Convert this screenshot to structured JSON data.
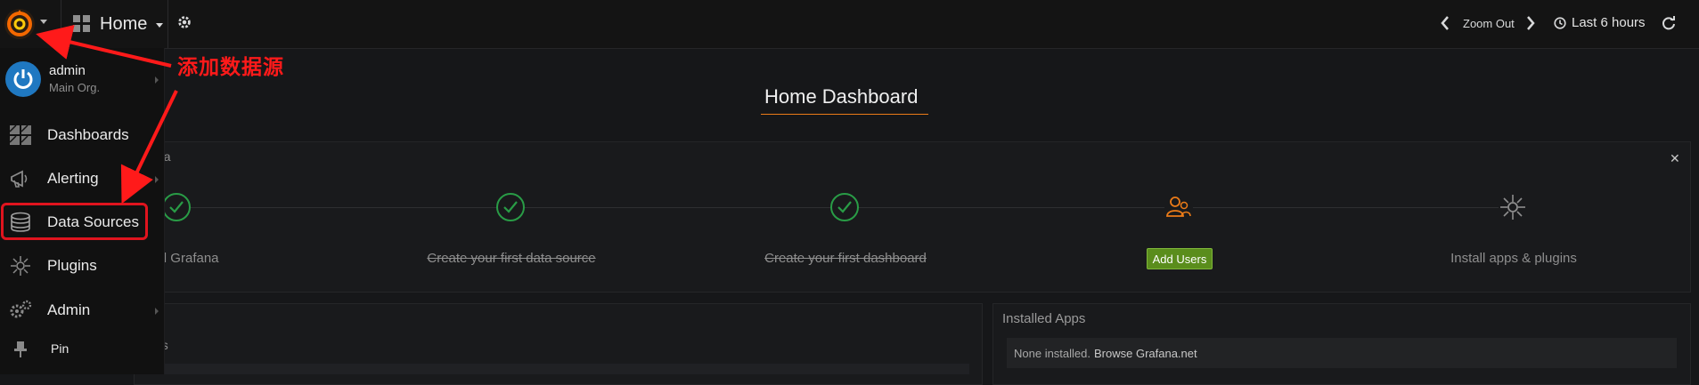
{
  "navbar": {
    "dashboard_title": "Home",
    "zoom_out_label": "Zoom Out",
    "time_range_label": "Last 6 hours"
  },
  "sidemenu": {
    "user": {
      "name": "admin",
      "org": "Main Org."
    },
    "items": [
      {
        "label": "Dashboards",
        "icon": "dashboards-icon"
      },
      {
        "label": "Alerting",
        "icon": "alerting-icon"
      },
      {
        "label": "Data Sources",
        "icon": "database-icon"
      },
      {
        "label": "Plugins",
        "icon": "plugins-icon"
      },
      {
        "label": "Admin",
        "icon": "admin-gears-icon"
      },
      {
        "label": "Pin",
        "icon": "pin-icon"
      }
    ]
  },
  "main": {
    "dashboard_title": "Home Dashboard",
    "getting_started": {
      "title_fragment": "na",
      "steps": [
        {
          "label": "ll Grafana",
          "done": true
        },
        {
          "label": "Create your first data source",
          "done": true
        },
        {
          "label": "Create your first dashboard",
          "done": true
        },
        {
          "label": "",
          "button": "Add Users",
          "done": false
        },
        {
          "label": "Install apps & plugins",
          "done": false
        }
      ]
    },
    "left_panel_fragment": "ds",
    "installed_apps": {
      "title": "Installed Apps",
      "empty_text": "None installed.",
      "link_text": "Browse Grafana.net"
    }
  },
  "annotation": {
    "text": "添加数据源"
  },
  "colors": {
    "accent_orange": "#eb7b18",
    "done_green": "#299c46",
    "button_green": "#5a8d1c",
    "annotation_red": "#ff1a1a",
    "avatar_blue": "#1f78c1"
  }
}
